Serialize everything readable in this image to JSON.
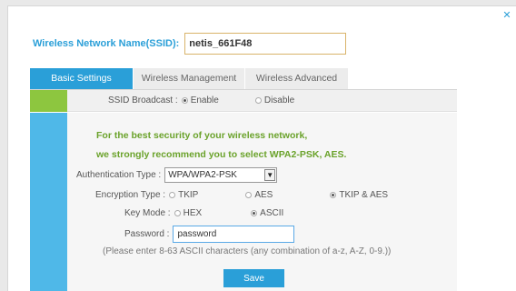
{
  "dialog": {
    "close_icon": "close-icon",
    "accent": "#2a9fd8"
  },
  "ssid": {
    "label": "Wireless Network Name(SSID):",
    "value": "netis_661F48"
  },
  "tabs": [
    {
      "label": "Basic Settings",
      "active": true
    },
    {
      "label": "Wireless Management",
      "active": false
    },
    {
      "label": "Wireless Advanced",
      "active": false
    }
  ],
  "broadcast": {
    "label": "SSID Broadcast :",
    "options": [
      "Enable",
      "Disable"
    ],
    "selected": "Enable"
  },
  "notes": [
    "For the best security of your wireless network,",
    "we strongly recommend you to select WPA2-PSK, AES."
  ],
  "auth": {
    "label": "Authentication Type :",
    "value": "WPA/WPA2-PSK"
  },
  "encryption": {
    "label": "Encryption Type :",
    "options": [
      "TKIP",
      "AES",
      "TKIP & AES"
    ],
    "selected": "TKIP & AES"
  },
  "key_mode": {
    "label": "Key Mode :",
    "options": [
      "HEX",
      "ASCII"
    ],
    "selected": "ASCII"
  },
  "password": {
    "label": "Password :",
    "value": "password"
  },
  "hint": "(Please enter 8-63 ASCII characters (any combination of a-z, A-Z, 0-9.))",
  "save_label": "Save",
  "colors": {
    "green_strip": "#8dc63f",
    "blue_strip": "#4fb8e8",
    "note_green": "#6aa22a"
  }
}
